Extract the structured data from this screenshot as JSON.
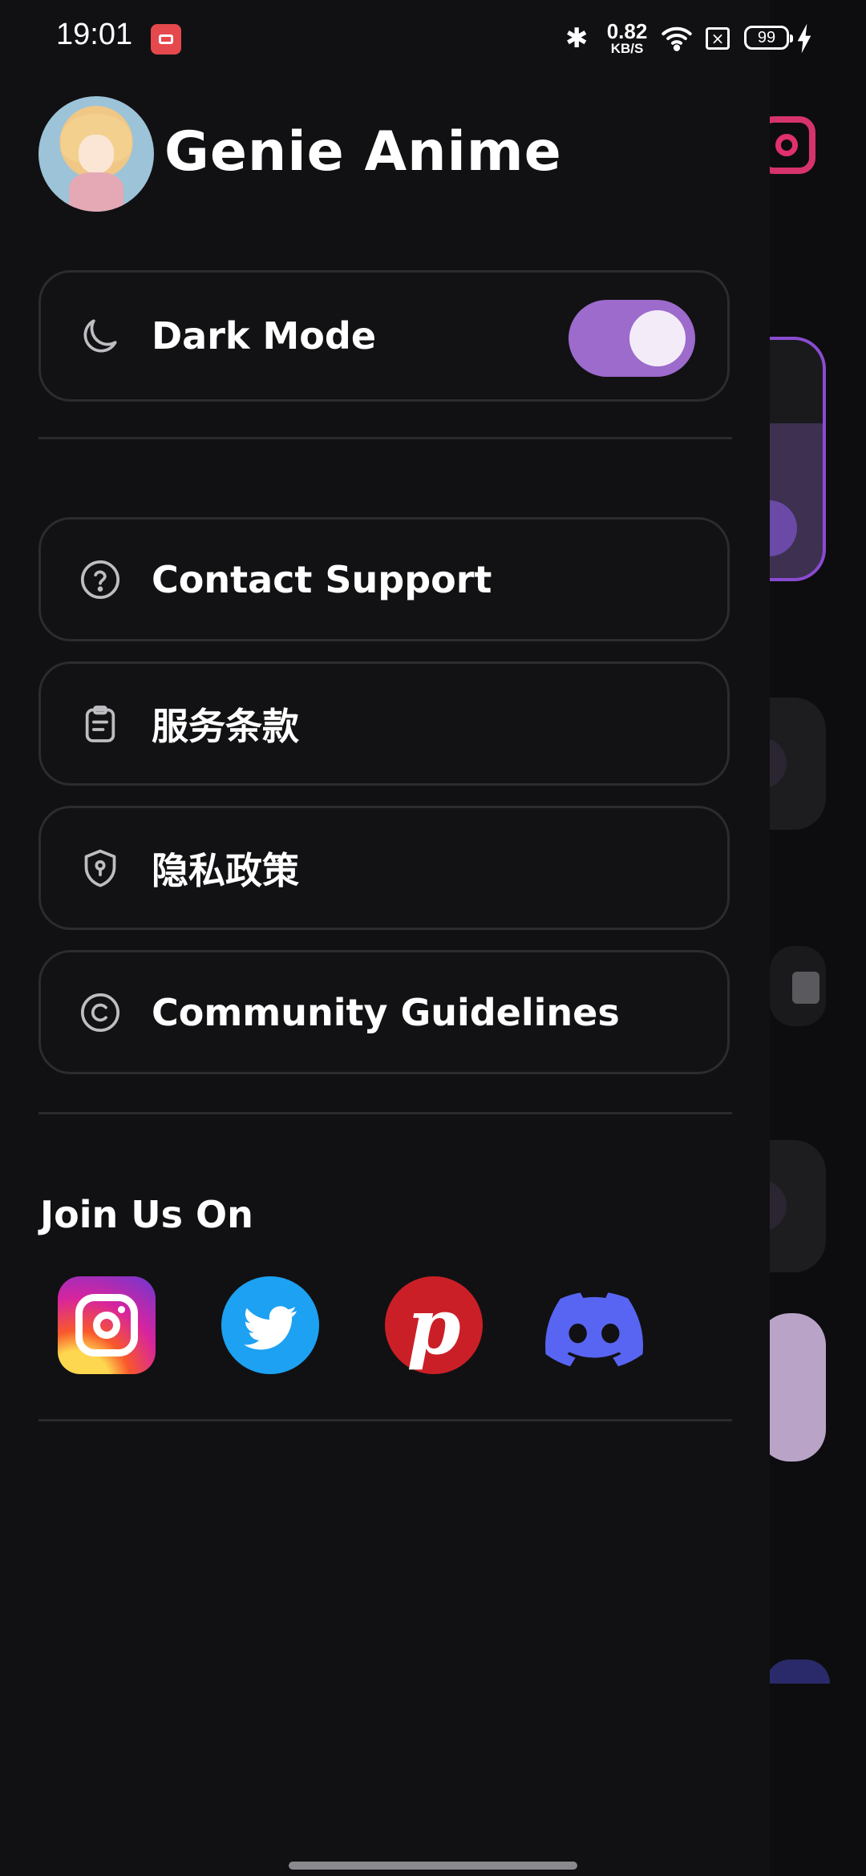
{
  "status_bar": {
    "time": "19:01",
    "net_speed_value": "0.82",
    "net_speed_unit": "KB/S",
    "battery_level": "99",
    "icons": [
      "screen-record-icon",
      "bluetooth-icon",
      "wifi-icon",
      "no-sim-icon",
      "battery-icon",
      "charging-icon"
    ]
  },
  "header": {
    "title": "Genie Anime"
  },
  "settings": {
    "dark_mode_label": "Dark Mode",
    "dark_mode_enabled": true
  },
  "menu": {
    "items": [
      {
        "label": "Contact Support",
        "icon": "help-circle-icon"
      },
      {
        "label": "服务条款",
        "icon": "clipboard-icon"
      },
      {
        "label": "隐私政策",
        "icon": "shield-icon"
      },
      {
        "label": "Community Guidelines",
        "icon": "copyright-icon"
      }
    ]
  },
  "social": {
    "title": "Join Us On",
    "links": [
      {
        "icon": "instagram-icon"
      },
      {
        "icon": "twitter-icon"
      },
      {
        "icon": "pinterest-icon"
      },
      {
        "icon": "discord-icon"
      }
    ]
  },
  "colors": {
    "accent": "#9c6bcc",
    "background": "#111113",
    "card_border": "#2c2c30"
  }
}
